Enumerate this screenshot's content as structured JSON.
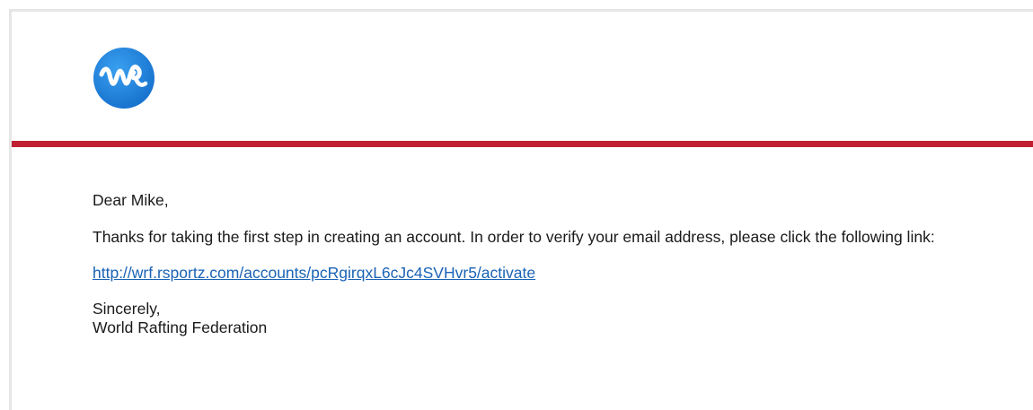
{
  "email": {
    "header": {
      "logo_icon": "wrf-logo-icon",
      "accent_color": "#c0202f",
      "logo_color": "#1e88e5"
    },
    "greeting": "Dear Mike,",
    "body": "Thanks for taking the first step in creating an account. In order to verify your email address, please click the following link:",
    "activation_link": "http://wrf.rsportz.com/accounts/pcRgirqxL6cJc4SVHvr5/activate",
    "closing": "Sincerely,",
    "signature": "World Rafting Federation"
  }
}
